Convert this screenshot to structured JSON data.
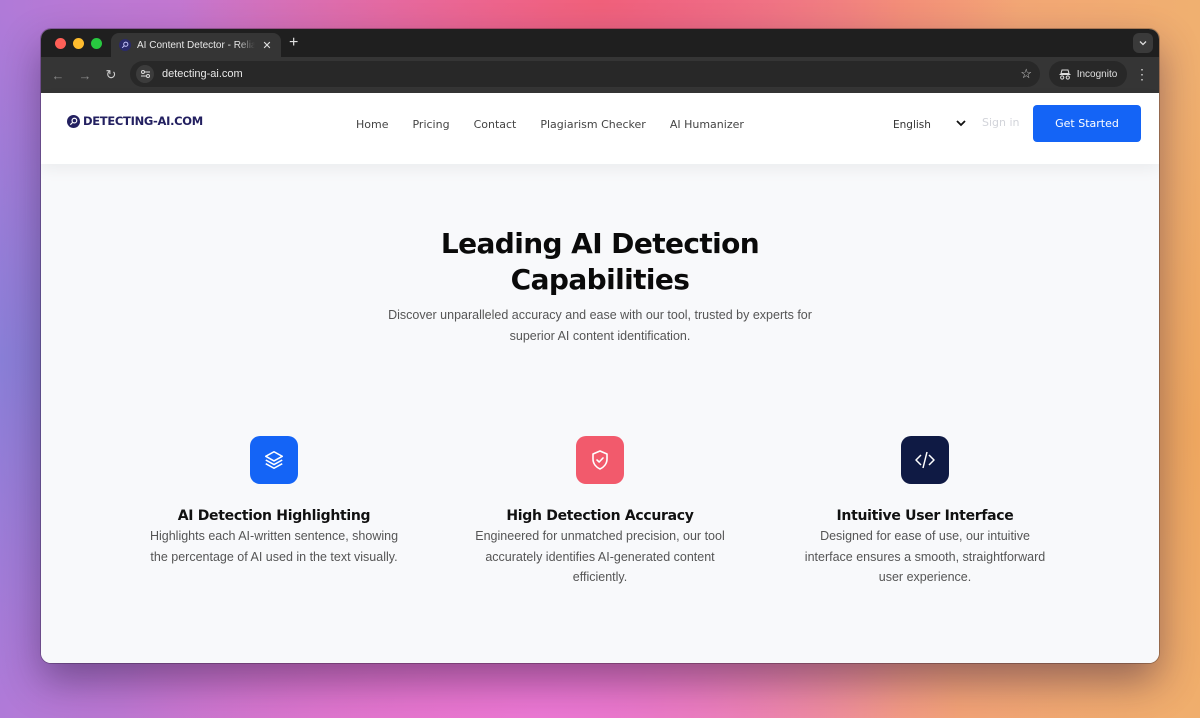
{
  "browser": {
    "tab_title": "AI Content Detector - Reliable AI Checker",
    "url": "detecting-ai.com",
    "incognito_label": "Incognito",
    "new_tab_label": "+",
    "close_tab_label": "✕"
  },
  "header": {
    "logo_text": "DETECTING-AI.COM",
    "nav": [
      {
        "label": "Home"
      },
      {
        "label": "Pricing"
      },
      {
        "label": "Contact"
      },
      {
        "label": "Plagiarism Checker"
      },
      {
        "label": "AI Humanizer"
      }
    ],
    "language": "English",
    "signin_label": "Sign in",
    "cta_label": "Get Started",
    "cta_color": "#1464f6"
  },
  "hero": {
    "title": "Leading AI Detection Capabilities",
    "subtitle": "Discover unparalleled accuracy and ease with our tool, trusted by experts for superior AI content identification."
  },
  "features": [
    {
      "icon": "layers-icon",
      "color": "#1464f6",
      "title": "AI Detection Highlighting",
      "description": "Highlights each AI-written sentence, showing the percentage of AI used in the text visually."
    },
    {
      "icon": "shield-check-icon",
      "color": "#f25a6c",
      "title": "High Detection Accuracy",
      "description": "Engineered for unmatched precision, our tool accurately identifies AI-generated content efficiently."
    },
    {
      "icon": "code-icon",
      "color": "#0f1a44",
      "title": "Intuitive User Interface",
      "description": "Designed for ease of use, our intuitive interface ensures a smooth, straightforward user experience."
    }
  ]
}
